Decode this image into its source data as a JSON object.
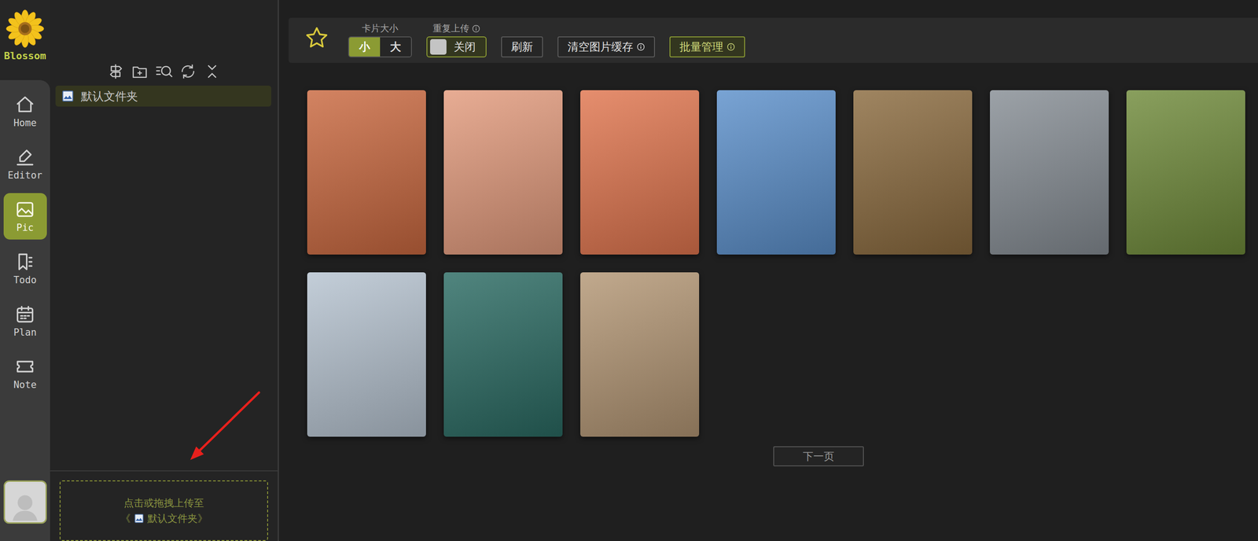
{
  "app": {
    "name": "Blossom"
  },
  "nav": [
    {
      "label": "Home",
      "selected": false
    },
    {
      "label": "Editor",
      "selected": false
    },
    {
      "label": "Pic",
      "selected": true
    },
    {
      "label": "Todo",
      "selected": false
    },
    {
      "label": "Plan",
      "selected": false
    },
    {
      "label": "Note",
      "selected": false
    }
  ],
  "folders": [
    {
      "name": "默认文件夹",
      "selected": true
    }
  ],
  "upload": {
    "line": "点击或拖拽上传至",
    "open": "《",
    "target": "默认文件夹",
    "close": "》"
  },
  "toolbar": {
    "cardSize": {
      "label": "卡片大小",
      "options": [
        {
          "label": "小",
          "selected": true
        },
        {
          "label": "大",
          "selected": false
        }
      ]
    },
    "repeatUpload": {
      "label": "重复上传",
      "on": false,
      "stateText": "关闭"
    },
    "buttons": [
      {
        "label": "刷新",
        "info": false,
        "kind": "plain"
      },
      {
        "label": "清空图片缓存",
        "info": true,
        "kind": "plain"
      },
      {
        "label": "批量管理",
        "info": true,
        "kind": "accent"
      }
    ]
  },
  "images": [
    {
      "color": "#c9683f"
    },
    {
      "color": "#e29a7c"
    },
    {
      "color": "#e0754e"
    },
    {
      "color": "#5b8fca"
    },
    {
      "color": "#8a6a3e"
    },
    {
      "color": "#868d94"
    },
    {
      "color": "#6f8a3a"
    },
    {
      "color": "#b6c3d0"
    },
    {
      "color": "#2a6a62"
    },
    {
      "color": "#b39674"
    }
  ],
  "pager": {
    "next": "下一页"
  }
}
